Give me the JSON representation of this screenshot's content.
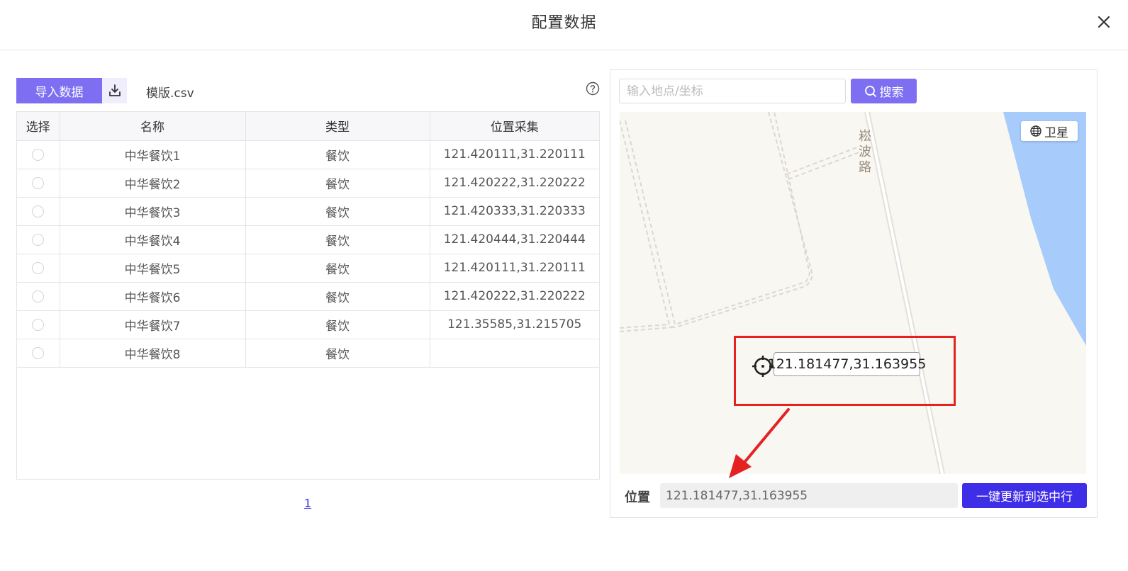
{
  "dialog": {
    "title": "配置数据"
  },
  "toolbar": {
    "import_label": "导入数据",
    "template_file": "模版.csv"
  },
  "table": {
    "columns": [
      "选择",
      "名称",
      "类型",
      "位置采集"
    ],
    "rows": [
      {
        "name": "中华餐饮1",
        "type": "餐饮",
        "location": "121.420111,31.220111"
      },
      {
        "name": "中华餐饮2",
        "type": "餐饮",
        "location": "121.420222,31.220222"
      },
      {
        "name": "中华餐饮3",
        "type": "餐饮",
        "location": "121.420333,31.220333"
      },
      {
        "name": "中华餐饮4",
        "type": "餐饮",
        "location": "121.420444,31.220444"
      },
      {
        "name": "中华餐饮5",
        "type": "餐饮",
        "location": "121.420111,31.220111"
      },
      {
        "name": "中华餐饮6",
        "type": "餐饮",
        "location": "121.420222,31.220222"
      },
      {
        "name": "中华餐饮7",
        "type": "餐饮",
        "location": "121.35585,31.215705"
      },
      {
        "name": "中华餐饮8",
        "type": "餐饮",
        "location": ""
      }
    ]
  },
  "pagination": {
    "current": "1"
  },
  "map_panel": {
    "search_placeholder": "输入地点/坐标",
    "search_label": "搜索",
    "satellite_label": "卫星",
    "road_label": "崧波路",
    "marker_coord": "121.181477,31.163955",
    "position_label": "位置",
    "position_value": "121.181477,31.163955",
    "update_label": "一键更新到选中行"
  },
  "colors": {
    "primary": "#7e6ff2",
    "update_button": "#3f2ee8",
    "highlight": "#e42222",
    "water": "#a7cbfb"
  }
}
